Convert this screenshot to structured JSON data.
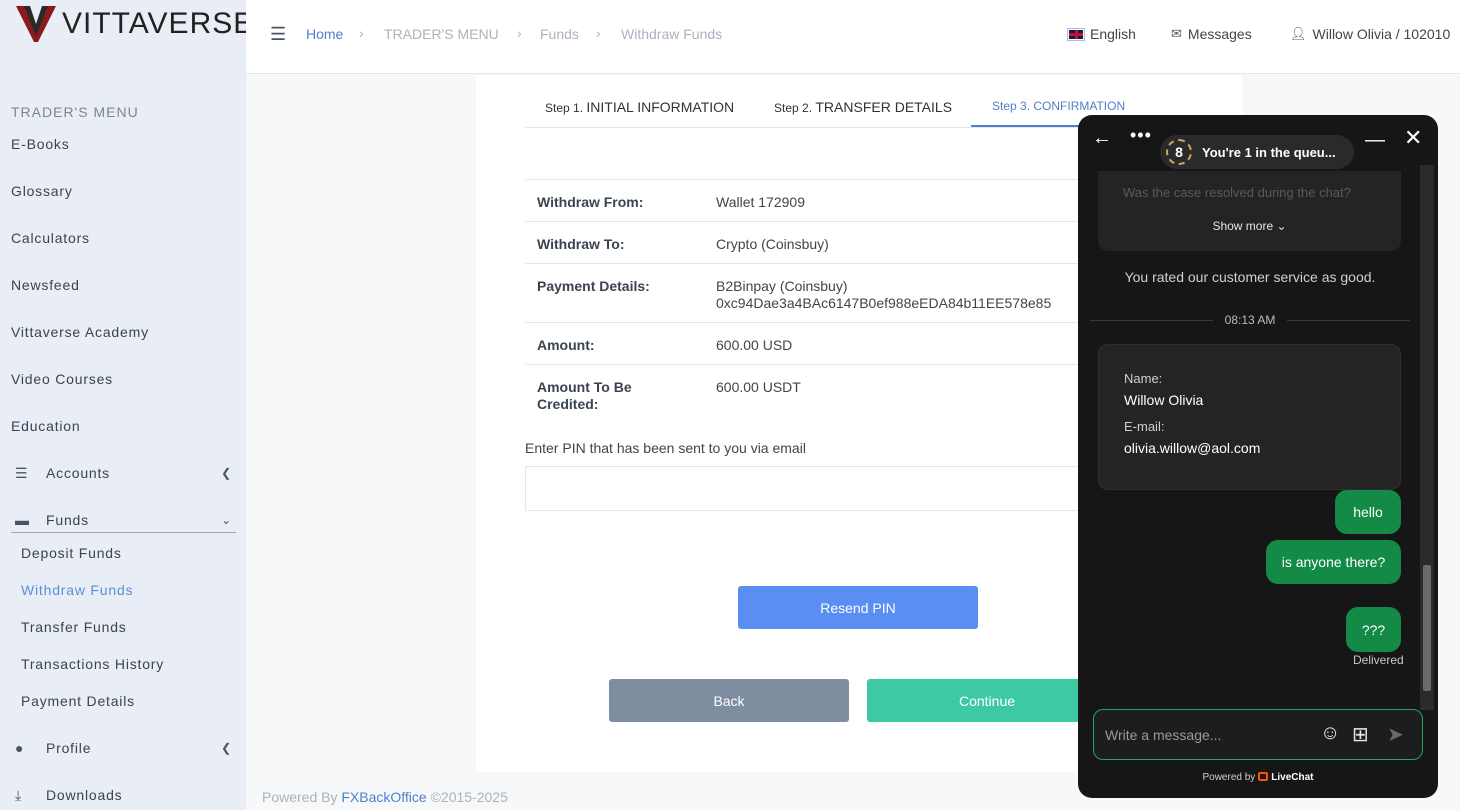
{
  "brand": {
    "name": "VITTAVERSE"
  },
  "sidebar": {
    "heading": "TRADER'S MENU",
    "links": [
      "E-Books",
      "Glossary",
      "Calculators",
      "Newsfeed",
      "Vittaverse Academy",
      "Video Courses",
      "Education"
    ],
    "groups": {
      "accounts": "Accounts",
      "funds": "Funds",
      "profile": "Profile",
      "downloads": "Downloads"
    },
    "funds_items": [
      "Deposit Funds",
      "Withdraw Funds",
      "Transfer Funds",
      "Transactions History",
      "Payment Details"
    ],
    "active_item": "Withdraw Funds"
  },
  "header": {
    "breadcrumb": [
      "Home",
      "TRADER'S MENU",
      "Funds",
      "Withdraw Funds"
    ],
    "language": "English",
    "messages": "Messages",
    "user": "Willow Olivia / 102010"
  },
  "steps": [
    {
      "prefix": "Step 1. ",
      "label": "INITIAL INFORMATION"
    },
    {
      "prefix": "Step 2. ",
      "label": "TRANSFER DETAILS"
    },
    {
      "prefix": "Step 3. ",
      "label": "CONFIRMATION"
    }
  ],
  "details": [
    {
      "label": "Withdraw From:",
      "value": "Wallet 172909"
    },
    {
      "label": "Withdraw To:",
      "value": "Crypto (Coinsbuy)"
    },
    {
      "label": "Payment Details:",
      "value": "B2Binpay (Coinsbuy)",
      "value2": "0xc94Dae3a4BAc6147B0ef988eEDA84b11EE578e85"
    },
    {
      "label": "Amount:",
      "value": "600.00 USD"
    },
    {
      "label": "Amount To Be Credited:",
      "value": "600.00 USDT"
    }
  ],
  "pin": {
    "label": "Enter PIN that has been sent to you via email",
    "value": ""
  },
  "buttons": {
    "resend": "Resend PIN",
    "back": "Back",
    "continue": "Continue"
  },
  "footer": {
    "prefix": "Powered By",
    "brand": "FXBackOffice",
    "years": "©2015-2025"
  },
  "chat": {
    "queue_number": "8",
    "queue_text": "You're 1 in the queu...",
    "faded_question": "Was the case resolved during the chat?",
    "show_more": "Show more ⌄",
    "rated": "You rated our customer service as good.",
    "time": "08:13 AM",
    "form": {
      "name_label": "Name:",
      "name": "Willow Olivia",
      "email_label": "E-mail:",
      "email": "olivia.willow@aol.com"
    },
    "messages": [
      "hello",
      "is anyone there?",
      "???"
    ],
    "status": "Delivered",
    "input_placeholder": "Write a message...",
    "powered_prefix": "Powered by",
    "powered_brand": "LiveChat"
  },
  "colors": {
    "accent": "#4f80c9",
    "resend": "#5b8ef2",
    "back": "#7f8da1",
    "continue": "#3ec9a5",
    "chat_bubble": "#138a46"
  }
}
